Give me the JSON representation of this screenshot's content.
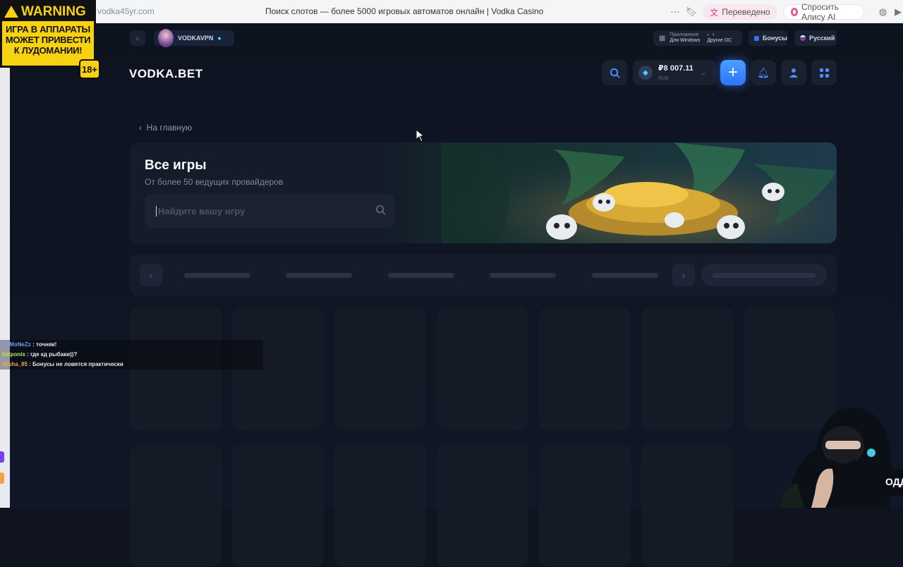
{
  "browser": {
    "url": "vodka45yr.com",
    "tab_title": "Поиск слотов — более 5000 игровых автоматов онлайн | Vodka Casino",
    "translated_label": "Переведено",
    "alice_label": "Спросить Алису AI"
  },
  "overlay": {
    "warning_title": "WARNING",
    "warning_text": [
      "ИГРА В АППАРАТЫ",
      "МОЖЕТ ПРИВЕСТИ",
      "К ЛУДОМАНИИ!"
    ],
    "age_badge": "18+"
  },
  "topbar": {
    "vpn_label": "VODKAVPN",
    "apps_windows_label": [
      "Приложение",
      "Для Windows"
    ],
    "apps_other_label": [
      "Другие ОС"
    ],
    "bonus_label": "Бонусы",
    "lang_label": "Русский"
  },
  "header": {
    "logo": "VODKA.BET",
    "balance_amount": "₽8 007.11",
    "balance_currency": "RUB"
  },
  "main": {
    "back_label": "На главную",
    "banner_title": "Все игры",
    "banner_subtitle": "От более 50 ведущих провайдеров",
    "search_placeholder": "Найдите вашу игру"
  },
  "chat": [
    {
      "user": "ReMoNeZz",
      "message": " : точняк!"
    },
    {
      "user": "lollponis",
      "message": " : где кд рыбаки))?"
    },
    {
      "user": "Misha_85",
      "message": " : Бонусы не ловятся практически"
    }
  ],
  "side_badge": "ОДД",
  "colors": {
    "accent": "#2f73ff",
    "background": "#0f1420",
    "warning_yellow": "#f7d210"
  }
}
